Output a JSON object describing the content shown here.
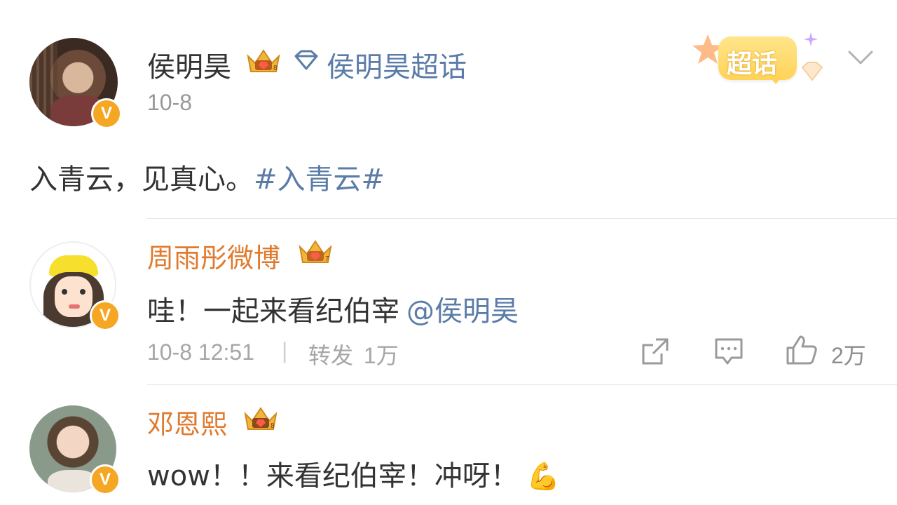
{
  "post": {
    "author_name": "侯明昊",
    "supertopic_label": "侯明昊超话",
    "date": "10-8",
    "content_text": "入青云，见真心。",
    "hashtag": "#入青云#",
    "supertopic_badge": "超话"
  },
  "comments": [
    {
      "name": "周雨彤微博",
      "text": "哇！一起来看纪伯宰",
      "mention": "@侯明昊",
      "time": "10-8 12:51",
      "separator": "|",
      "repost_label": "转发",
      "repost_count": "1万",
      "like_count": "2万"
    },
    {
      "name": "邓恩熙",
      "text": "wow！！来看纪伯宰！冲呀！",
      "emoji": "💪"
    }
  ],
  "colors": {
    "link_blue": "#5b7ca8",
    "name_orange": "#e07a2e",
    "verified_badge": "#f5a623",
    "meta_gray": "#a6a6a6"
  },
  "icons": {
    "verified": "V",
    "diamond": "diamond-icon",
    "share": "share-icon",
    "comment": "comment-icon",
    "like": "thumbs-up-icon",
    "expand": "chevron-down-icon"
  }
}
